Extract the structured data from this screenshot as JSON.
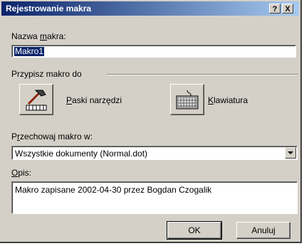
{
  "window": {
    "title": "Rejestrowanie makra",
    "help_label": "?",
    "close_label": "X"
  },
  "macro_name": {
    "label_pre": "Nazwa ",
    "label_key": "m",
    "label_post": "akra:",
    "value": "Makro1"
  },
  "assign": {
    "group_label": "Przypisz makro do",
    "toolbars": {
      "label_key": "P",
      "label_post": "aski narzędzi",
      "icon": "hammer-icon"
    },
    "keyboard": {
      "label_key": "K",
      "label_post": "lawiatura",
      "icon": "keyboard-icon"
    }
  },
  "store": {
    "label_pre": "P",
    "label_key": "r",
    "label_post": "zechowaj makro w:",
    "value": "Wszystkie dokumenty (Normal.dot)"
  },
  "description": {
    "label_key": "O",
    "label_post": "pis:",
    "value": "Makro zapisane 2002-04-30 przez Bogdan Czogalik"
  },
  "buttons": {
    "ok": "OK",
    "cancel": "Anuluj"
  },
  "colors": {
    "titlebar_start": "#0a246a",
    "titlebar_end": "#a6caf0",
    "face": "#d4d0c8",
    "selection": "#0a246a"
  }
}
